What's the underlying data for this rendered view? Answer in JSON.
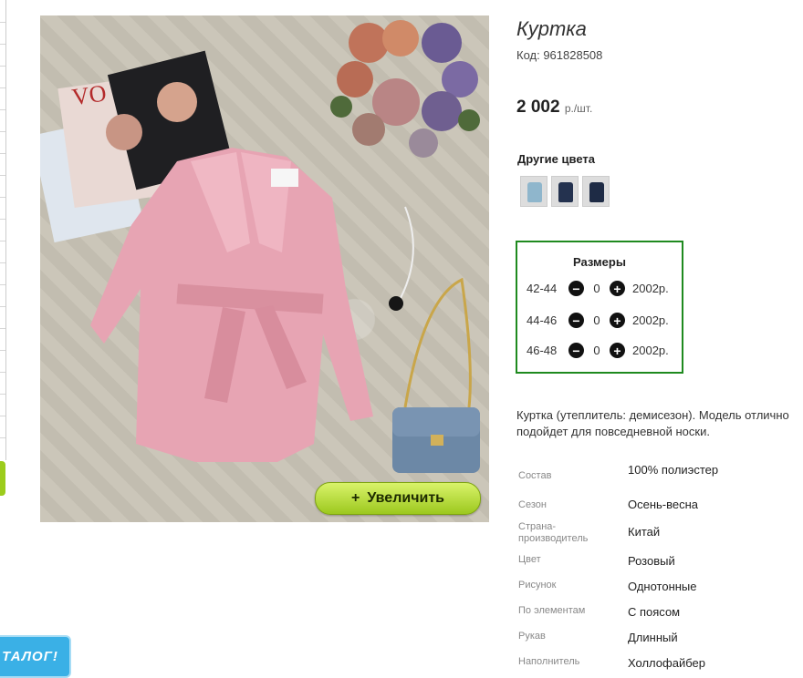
{
  "product": {
    "title": "Куртка",
    "code": "Код: 961828508",
    "price": "2 002",
    "price_unit": "р./шт."
  },
  "image": {
    "zoom_label": "Увеличить",
    "zoom_icon": "+"
  },
  "other_colors": {
    "title": "Другие цвета",
    "swatches": [
      {
        "color": "#8fb6cc"
      },
      {
        "color": "#24324f"
      },
      {
        "color": "#1e2b45"
      }
    ]
  },
  "sizes": {
    "title": "Размеры",
    "rows": [
      {
        "size": "42-44",
        "qty": "0",
        "price": "2002р."
      },
      {
        "size": "44-46",
        "qty": "0",
        "price": "2002р."
      },
      {
        "size": "46-48",
        "qty": "0",
        "price": "2002р."
      }
    ]
  },
  "description": {
    "line1": "Куртка (утеплитель: демисезон). Модель отлично",
    "line2": "подойдет для повседневной носки."
  },
  "properties": [
    {
      "key": "Состав",
      "value": "100% полиэстер"
    },
    {
      "key": "Сезон",
      "value": "Осень-весна"
    },
    {
      "key": "Страна-производитель",
      "value": "Китай"
    },
    {
      "key": "Цвет",
      "value": "Розовый"
    },
    {
      "key": "Рисунок",
      "value": "Однотонные"
    },
    {
      "key": "По элементам",
      "value": "С поясом"
    },
    {
      "key": "Рукав",
      "value": "Длинный"
    },
    {
      "key": "Наполнитель",
      "value": "Холлофайбер"
    }
  ],
  "catalog_badge": "ТАЛОГ!",
  "colors": {
    "accent_green": "#1f8a1f",
    "zoom_green": "#9cc81e",
    "badge_blue": "#3ab0e6"
  }
}
